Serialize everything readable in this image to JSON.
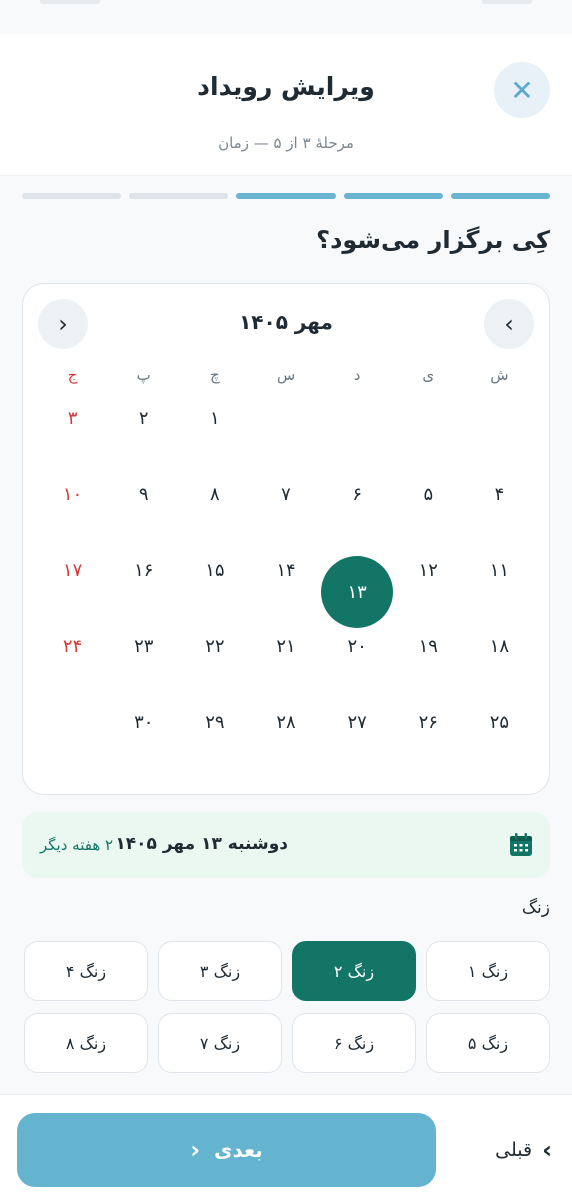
{
  "header": {
    "title": "ویرایش رویداد",
    "subtitle": "مرحلهٔ ۳ از ۵ — زمان",
    "close_icon": "close-icon"
  },
  "progress": {
    "total_steps": 5,
    "completed_steps": 3
  },
  "question": "کِی برگزار می‌شود؟",
  "calendar": {
    "month_label": "مهر ۱۴۰۵",
    "weekdays": [
      "ش",
      "ی",
      "د",
      "س",
      "چ",
      "پ",
      "ج"
    ],
    "weeks": [
      [
        "",
        "",
        "",
        "",
        "۱",
        "۲",
        "۳"
      ],
      [
        "۴",
        "۵",
        "۶",
        "۷",
        "۸",
        "۹",
        "۱۰"
      ],
      [
        "۱۱",
        "۱۲",
        "۱۳",
        "۱۴",
        "۱۵",
        "۱۶",
        "۱۷"
      ],
      [
        "۱۸",
        "۱۹",
        "۲۰",
        "۲۱",
        "۲۲",
        "۲۳",
        "۲۴"
      ],
      [
        "۲۵",
        "۲۶",
        "۲۷",
        "۲۸",
        "۲۹",
        "۳۰",
        ""
      ]
    ],
    "selected_day": "۱۳",
    "holiday_color": "#d33a3a",
    "selected_color": "#137566"
  },
  "summary": {
    "date_text": "دوشنبه ۱۳ مهر ۱۴۰۵",
    "relative_text": "۲ هفته دیگر",
    "icon": "calendar-icon"
  },
  "periods": {
    "label": "زنگ",
    "items": [
      "زنگ ۱",
      "زنگ ۲",
      "زنگ ۳",
      "زنگ ۴",
      "زنگ ۵",
      "زنگ ۶",
      "زنگ ۷",
      "زنگ ۸"
    ],
    "selected": "زنگ ۲"
  },
  "footer": {
    "next_label": "بعدی",
    "prev_label": "قبلی"
  },
  "colors": {
    "accent": "#137566",
    "primary_button": "#64b3cf",
    "progress_done": "#6ab4d1",
    "summary_bg": "#ebf8f2"
  }
}
